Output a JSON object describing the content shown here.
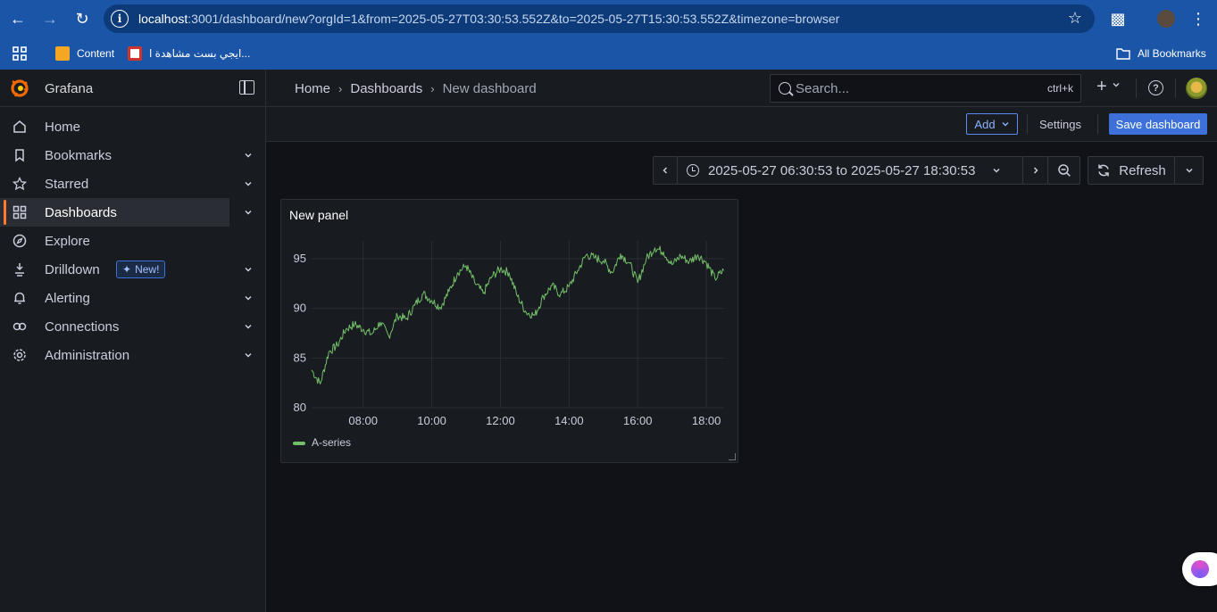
{
  "browser": {
    "url_host": "localhost",
    "url_rest": ":3001/dashboard/new?orgId=1&from=2025-05-27T03:30:53.552Z&to=2025-05-27T15:30:53.552Z&timezone=browser",
    "bookmarks": [
      {
        "label": "Content",
        "icon": "content-favicon",
        "color": "#f5a623"
      },
      {
        "label": "ايجي بست مشاهدة ا...",
        "icon": "egybest-favicon",
        "color": "#d0342c"
      }
    ],
    "all_bookmarks": "All Bookmarks"
  },
  "grafana": {
    "brand": "Grafana",
    "accent": "#ff7b2c",
    "nav": [
      {
        "label": "Home",
        "icon": "home-icon",
        "chevron": false,
        "active": false
      },
      {
        "label": "Bookmarks",
        "icon": "bookmark-icon",
        "chevron": true,
        "active": false
      },
      {
        "label": "Starred",
        "icon": "star-icon",
        "chevron": true,
        "active": false
      },
      {
        "label": "Dashboards",
        "icon": "apps-icon",
        "chevron": true,
        "active": true
      },
      {
        "label": "Explore",
        "icon": "compass-icon",
        "chevron": false,
        "active": false
      },
      {
        "label": "Drilldown",
        "icon": "drilldown-icon",
        "chevron": true,
        "active": false,
        "badge": "New!"
      },
      {
        "label": "Alerting",
        "icon": "bell-icon",
        "chevron": true,
        "active": false
      },
      {
        "label": "Connections",
        "icon": "connections-icon",
        "chevron": true,
        "active": false
      },
      {
        "label": "Administration",
        "icon": "cog-icon",
        "chevron": true,
        "active": false
      }
    ],
    "breadcrumbs": [
      "Home",
      "Dashboards",
      "New dashboard"
    ],
    "search": {
      "placeholder": "Search...",
      "shortcut": "ctrl+k"
    },
    "actions": {
      "add": "Add",
      "settings": "Settings",
      "save": "Save dashboard",
      "primary_color": "#3d71d9"
    },
    "time_range": "2025-05-27 06:30:53 to 2025-05-27 18:30:53",
    "refresh": "Refresh"
  },
  "panel": {
    "title": "New panel",
    "series_color": "#73bf69"
  },
  "chart_data": {
    "type": "line",
    "title": "New panel",
    "xlabel": "",
    "ylabel": "",
    "x_ticks": [
      "08:00",
      "10:00",
      "12:00",
      "14:00",
      "16:00",
      "18:00"
    ],
    "y_ticks": [
      80,
      85,
      90,
      95
    ],
    "ylim": [
      80,
      96.8
    ],
    "xlim": [
      "06:30",
      "18:31"
    ],
    "legend": "bottom-left",
    "grid": true,
    "series": [
      {
        "name": "A-series",
        "color": "#73bf69",
        "x": [
          "06:30",
          "06:45",
          "07:00",
          "07:15",
          "07:30",
          "07:45",
          "08:00",
          "08:15",
          "08:30",
          "08:45",
          "09:00",
          "09:15",
          "09:30",
          "09:45",
          "10:00",
          "10:15",
          "10:30",
          "10:45",
          "11:00",
          "11:15",
          "11:30",
          "11:45",
          "12:00",
          "12:15",
          "12:30",
          "12:45",
          "13:00",
          "13:15",
          "13:30",
          "13:45",
          "14:00",
          "14:15",
          "14:30",
          "14:45",
          "15:00",
          "15:15",
          "15:30",
          "15:45",
          "16:00",
          "16:15",
          "16:30",
          "16:45",
          "17:00",
          "17:15",
          "17:30",
          "17:45",
          "18:00",
          "18:15",
          "18:30"
        ],
        "values": [
          83.8,
          82.4,
          85.6,
          86.3,
          87.9,
          88.4,
          87.9,
          87.4,
          88.6,
          87.2,
          89.3,
          88.9,
          90.3,
          91.5,
          90.8,
          90.1,
          91.7,
          93.6,
          94.3,
          92.6,
          91.5,
          93.2,
          94.0,
          93.6,
          91.2,
          89.6,
          89.3,
          91.2,
          92.3,
          91.4,
          92.2,
          93.8,
          95.4,
          95.1,
          94.8,
          93.6,
          95.5,
          94.6,
          92.6,
          95.0,
          96.1,
          95.7,
          94.4,
          95.3,
          94.7,
          95.4,
          94.6,
          93.0,
          93.8
        ]
      }
    ]
  }
}
